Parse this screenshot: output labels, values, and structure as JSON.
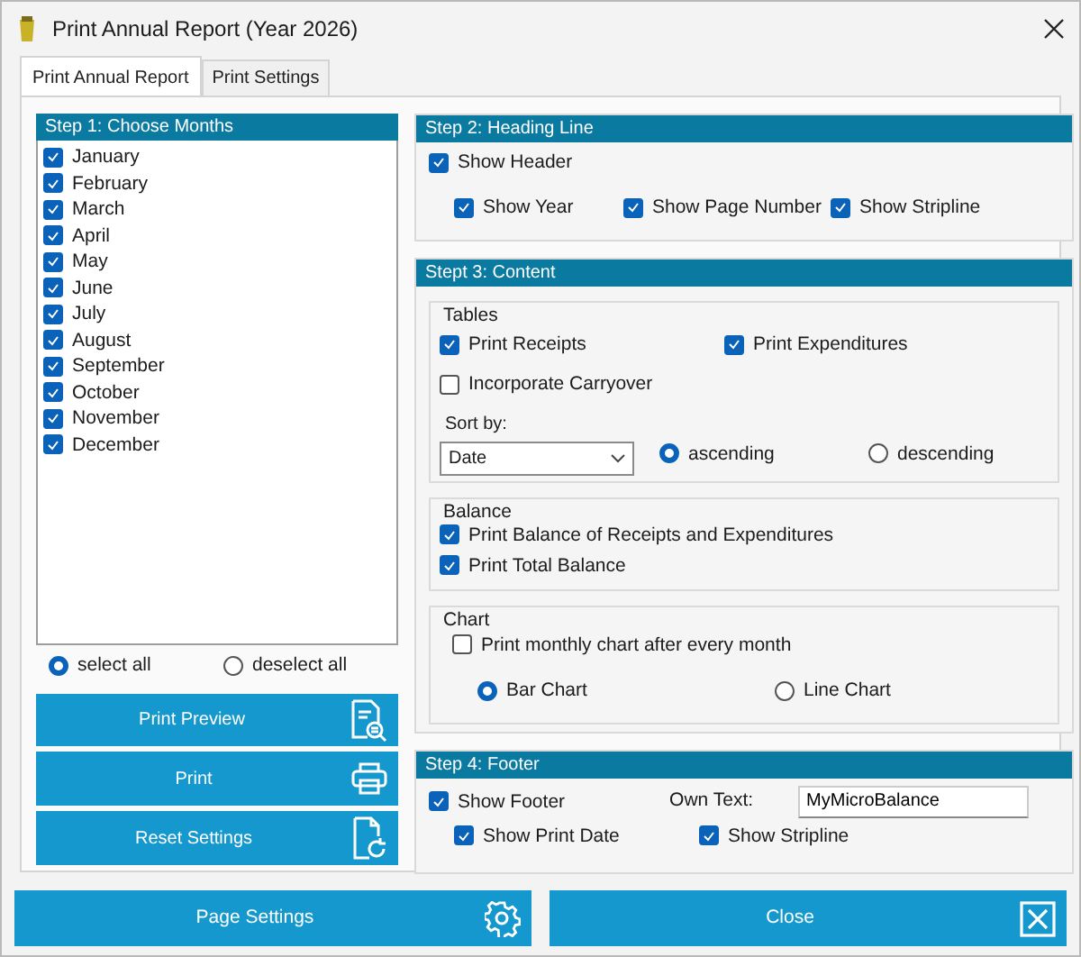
{
  "window": {
    "title": "Print Annual Report (Year 2026)"
  },
  "tabs": [
    {
      "label": "Print Annual Report",
      "selected": true
    },
    {
      "label": "Print Settings",
      "selected": false
    }
  ],
  "months": {
    "title": "Step 1: Choose Months",
    "items": [
      {
        "label": "January",
        "checked": true
      },
      {
        "label": "February",
        "checked": true
      },
      {
        "label": "March",
        "checked": true
      },
      {
        "label": "April",
        "checked": true
      },
      {
        "label": "May",
        "checked": true
      },
      {
        "label": "June",
        "checked": true
      },
      {
        "label": "July",
        "checked": true
      },
      {
        "label": "August",
        "checked": true
      },
      {
        "label": "September",
        "checked": true
      },
      {
        "label": "October",
        "checked": true
      },
      {
        "label": "November",
        "checked": true
      },
      {
        "label": "December",
        "checked": true
      }
    ]
  },
  "month_selection": [
    {
      "label": "select all",
      "selected": true
    },
    {
      "label": "deselect all",
      "selected": false
    }
  ],
  "actions": [
    {
      "label": "Print Preview",
      "kind": "preview"
    },
    {
      "label": "Print",
      "kind": "print"
    },
    {
      "label": "Reset Settings",
      "kind": "reset"
    }
  ],
  "heading_line": {
    "title": "Step 2: Heading Line",
    "show_header": {
      "label": "Show Header",
      "checked": true
    },
    "options": [
      {
        "label": "Show Year",
        "checked": true
      },
      {
        "label": "Show Page Number",
        "checked": true
      },
      {
        "label": "Show Stripline",
        "checked": true
      }
    ]
  },
  "content": {
    "title": "Stept 3: Content",
    "tables": {
      "title": "Tables",
      "options": [
        {
          "label": "Print Receipts",
          "checked": true
        },
        {
          "label": "Print Expenditures",
          "checked": true
        },
        {
          "label": "Incorporate Carryover",
          "checked": false
        }
      ],
      "sort_label": "Sort by:",
      "sort_value": "Date",
      "sort_order": [
        {
          "label": "ascending",
          "selected": true
        },
        {
          "label": "descending",
          "selected": false
        }
      ]
    },
    "balance": {
      "title": "Balance",
      "options": [
        {
          "label": "Print Balance of Receipts and Expenditures",
          "checked": true
        },
        {
          "label": "Print Total Balance",
          "checked": true
        }
      ]
    },
    "chart": {
      "title": "Chart",
      "monthly": {
        "label": "Print monthly chart after every month",
        "checked": false
      },
      "types": [
        {
          "label": "Bar Chart",
          "selected": true
        },
        {
          "label": "Line Chart",
          "selected": false
        }
      ]
    }
  },
  "footer": {
    "title": "Step 4: Footer",
    "show_footer": {
      "label": "Show Footer",
      "checked": true
    },
    "own_text_label": "Own Text:",
    "own_text_value": "MyMicroBalance",
    "options": [
      {
        "label": "Show Print Date",
        "checked": true
      },
      {
        "label": "Show Stripline",
        "checked": true
      }
    ]
  },
  "bottom_buttons": [
    {
      "label": "Page Settings",
      "kind": "settings"
    },
    {
      "label": "Close",
      "kind": "close"
    }
  ]
}
